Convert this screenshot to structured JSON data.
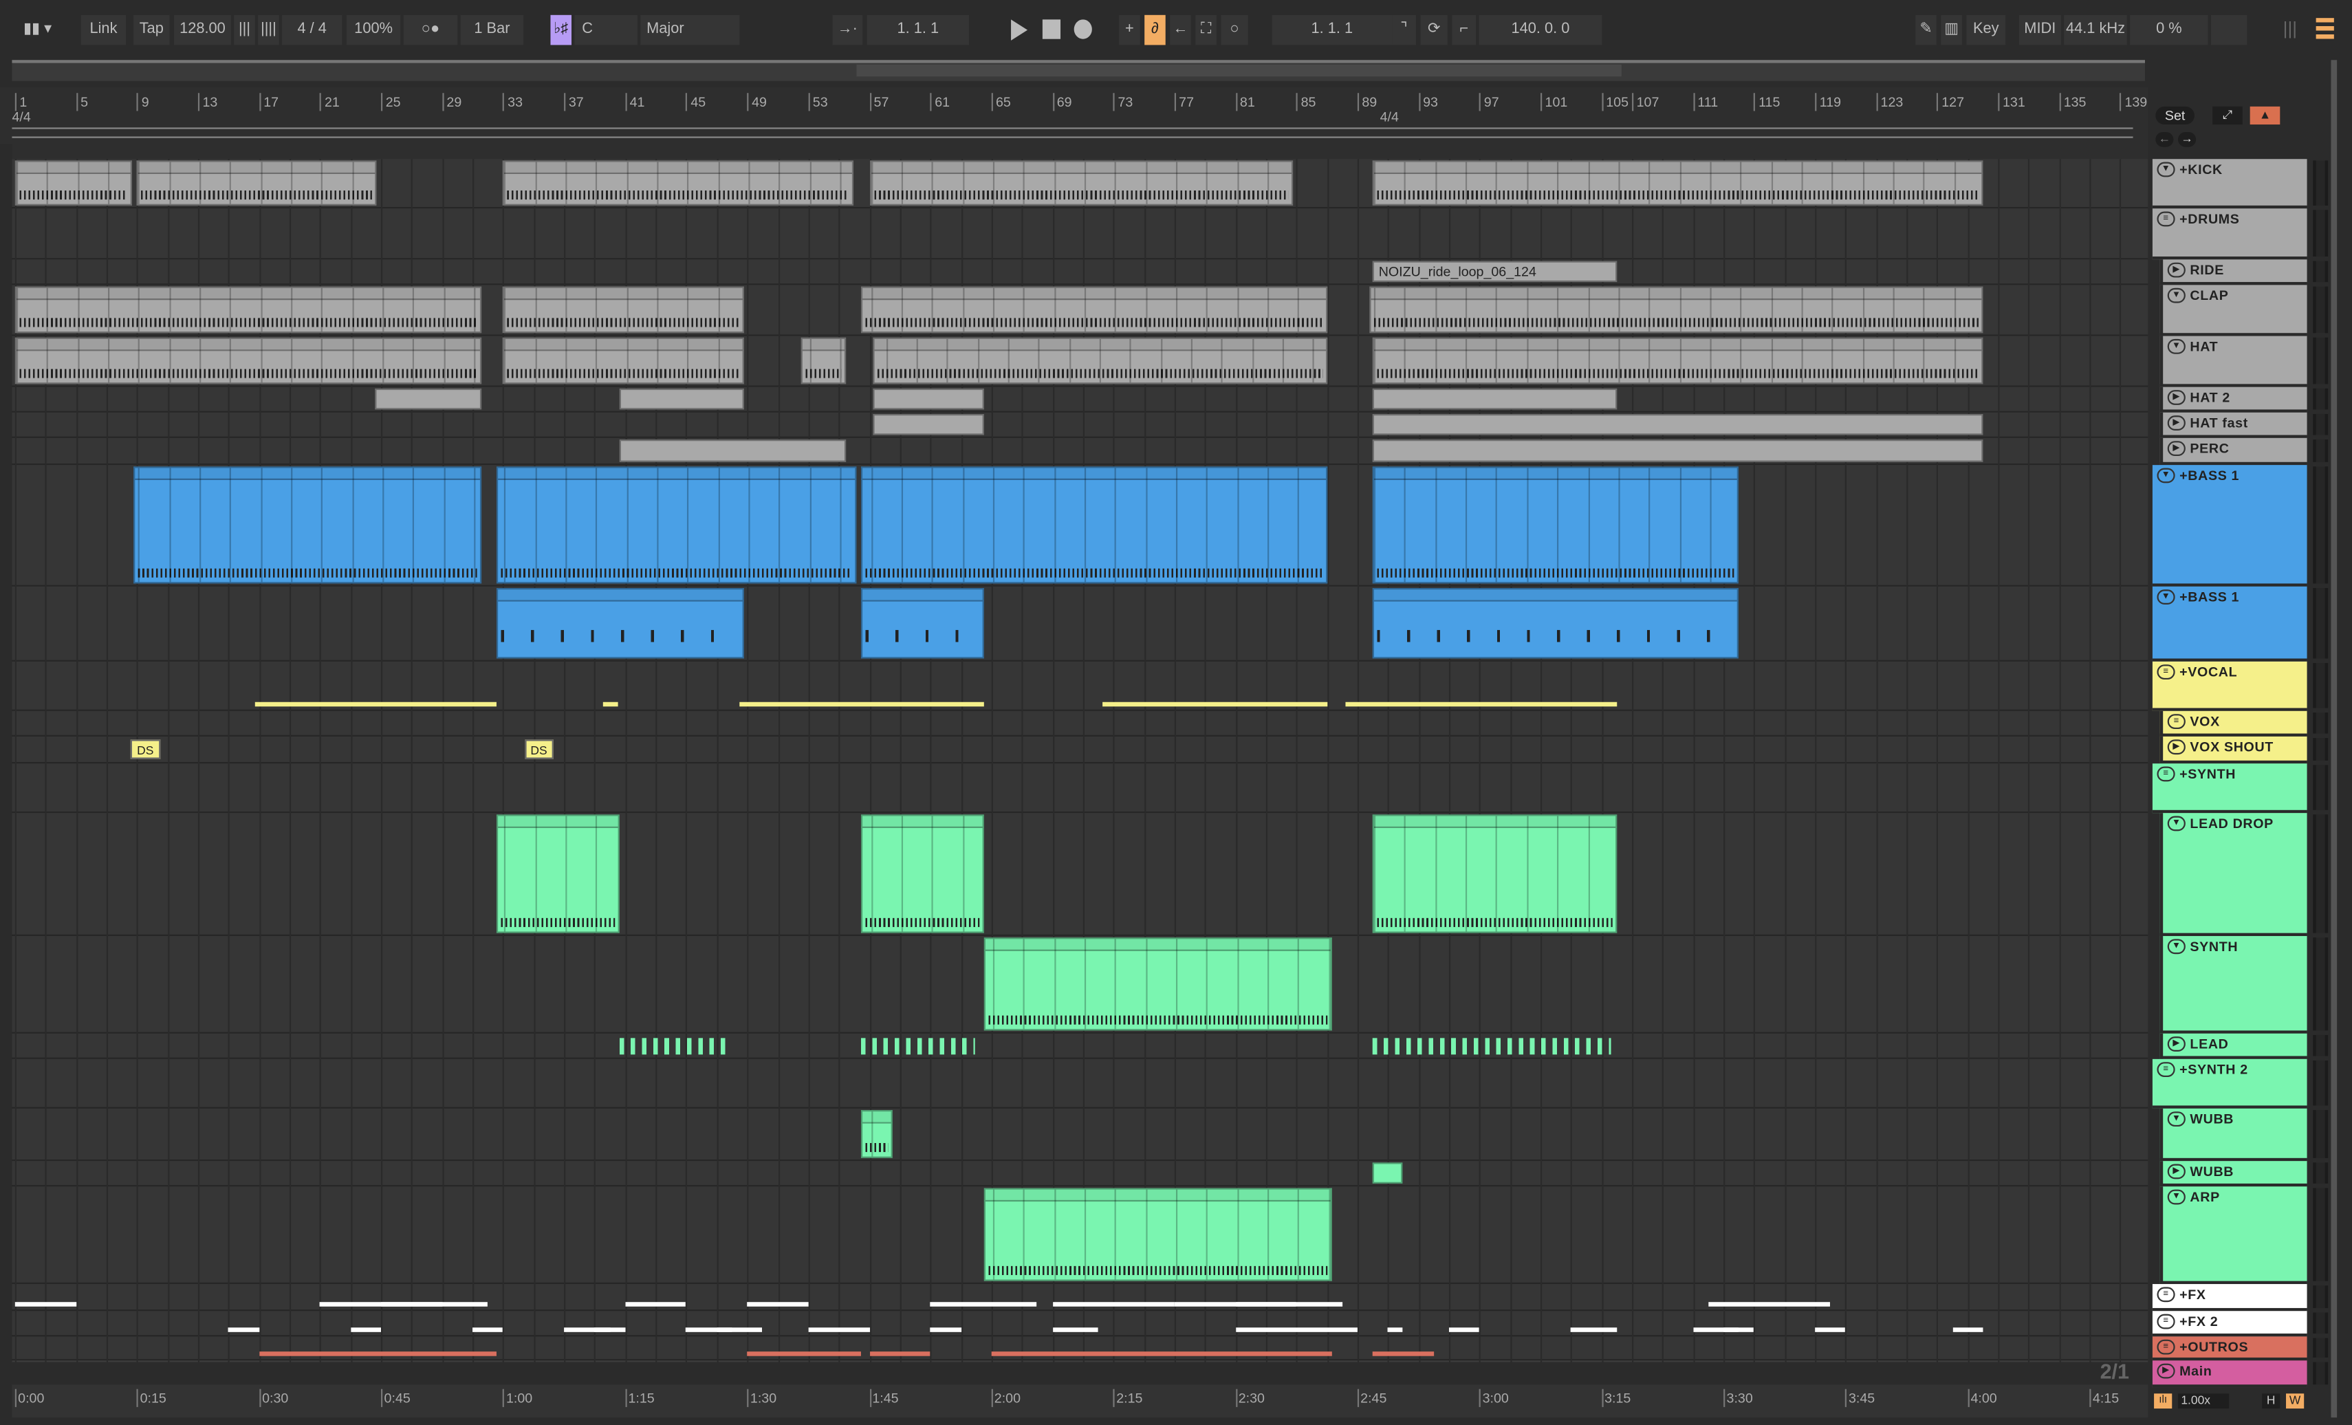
{
  "toolbar": {
    "link": "Link",
    "tap": "Tap",
    "tempo": "128.00",
    "signature": "4 / 4",
    "zoom": "100%",
    "follow": "○●",
    "quantize": "1 Bar",
    "scale_icon": "♭♯",
    "key": "C",
    "scale": "Major",
    "position": "1.  1.  1",
    "loop_start": "1.  1.  1",
    "loop_length": "140.  0.  0",
    "key_map": "Key",
    "midi_map": "MIDI",
    "sample_rate": "44.1 kHz",
    "cpu": "0 %",
    "accent": "#f3ad63",
    "scale_accent": "#b79cf5"
  },
  "ruler": {
    "bars": [
      1,
      5,
      9,
      13,
      17,
      21,
      25,
      29,
      33,
      37,
      41,
      45,
      49,
      53,
      57,
      61,
      65,
      69,
      73,
      77,
      81,
      85,
      89,
      93,
      97,
      101,
      105,
      107,
      111,
      115,
      119,
      123,
      127,
      131,
      135,
      139
    ],
    "signature": "4/4",
    "signature2": "4/4"
  },
  "set_button": "Set",
  "tracks": [
    {
      "name": "+KICK",
      "color": "#a9a9a9",
      "icon": "fold",
      "group": true,
      "clips": [
        [
          1,
          8.7
        ],
        [
          9,
          24.7
        ],
        [
          33,
          56
        ],
        [
          57,
          84.8
        ],
        [
          90,
          130
        ]
      ],
      "kind": "midi"
    },
    {
      "name": "+DRUMS",
      "color": "#a9a9a9",
      "icon": "group",
      "group": true,
      "clips": [],
      "kind": "midi"
    },
    {
      "name": "RIDE",
      "color": "#a9a9a9",
      "icon": "play",
      "group": false,
      "clips": [
        [
          90,
          106
        ]
      ],
      "clip_label": "NOIZU_ride_loop_06_124",
      "kind": "audio"
    },
    {
      "name": "CLAP",
      "color": "#a9a9a9",
      "icon": "fold",
      "group": false,
      "clips": [
        [
          1,
          31.6
        ],
        [
          33,
          48.8
        ],
        [
          56.5,
          87
        ],
        [
          89.8,
          130
        ]
      ],
      "kind": "midi"
    },
    {
      "name": "HAT",
      "color": "#a9a9a9",
      "icon": "fold",
      "group": false,
      "clips": [
        [
          1,
          31.6
        ],
        [
          33,
          48.8
        ],
        [
          52.5,
          55.5
        ],
        [
          57.2,
          87
        ],
        [
          90,
          130
        ]
      ],
      "kind": "midi"
    },
    {
      "name": "HAT 2",
      "color": "#a9a9a9",
      "icon": "play",
      "group": false,
      "clips": [
        [
          24.6,
          31.6
        ],
        [
          40.6,
          48.8
        ],
        [
          57.2,
          64.5
        ],
        [
          90,
          106
        ]
      ],
      "kind": "flat"
    },
    {
      "name": "HAT  fast",
      "color": "#a9a9a9",
      "icon": "play",
      "group": false,
      "clips": [
        [
          57.2,
          64.5
        ],
        [
          90,
          130
        ]
      ],
      "kind": "flat"
    },
    {
      "name": "PERC",
      "color": "#a9a9a9",
      "icon": "play",
      "group": false,
      "clips": [
        [
          40.6,
          55.5
        ],
        [
          90,
          130
        ]
      ],
      "kind": "flat"
    },
    {
      "name": "+BASS 1",
      "color": "#4aa0e6",
      "icon": "fold",
      "group": true,
      "clips": [
        [
          8.8,
          31.6
        ],
        [
          32.6,
          56.2
        ],
        [
          56.5,
          87
        ],
        [
          90,
          114
        ]
      ],
      "kind": "midi"
    },
    {
      "name": "+BASS 1",
      "color": "#4aa0e6",
      "icon": "fold",
      "group": true,
      "clips": [
        [
          32.6,
          48.8
        ],
        [
          56.5,
          64.5
        ],
        [
          90,
          114
        ]
      ],
      "kind": "sparse"
    },
    {
      "name": "+VOCAL",
      "color": "#f5f08a",
      "icon": "group",
      "group": true,
      "clips": [
        [
          16.7,
          32.6
        ],
        [
          39.5,
          40.5
        ],
        [
          48.5,
          64.5
        ],
        [
          72.3,
          87
        ],
        [
          88.2,
          106
        ]
      ],
      "kind": "thin"
    },
    {
      "name": "VOX",
      "color": "#f5f08a",
      "icon": "group",
      "group": false,
      "clips": [],
      "kind": "flat"
    },
    {
      "name": "VOX SHOUT",
      "color": "#f5f08a",
      "icon": "play",
      "group": false,
      "clips": [
        [
          8.6,
          10.5
        ],
        [
          34.4,
          36.3
        ]
      ],
      "clip_label": "DS",
      "kind": "label"
    },
    {
      "name": "+SYNTH",
      "color": "#7af5b0",
      "icon": "group",
      "group": true,
      "clips": [],
      "kind": "flat"
    },
    {
      "name": "LEAD DROP",
      "color": "#7af5b0",
      "icon": "fold",
      "group": false,
      "clips": [
        [
          32.6,
          40.6
        ],
        [
          56.5,
          64.5
        ],
        [
          90,
          106
        ]
      ],
      "kind": "midi"
    },
    {
      "name": "SYNTH",
      "color": "#7af5b0",
      "icon": "fold",
      "group": false,
      "clips": [
        [
          64.5,
          87.3
        ]
      ],
      "kind": "midi"
    },
    {
      "name": "LEAD",
      "color": "#7af5b0",
      "icon": "play",
      "group": false,
      "clips": [
        [
          40.6,
          48
        ],
        [
          56.5,
          63.9
        ],
        [
          90,
          105.6
        ]
      ],
      "kind": "pulse"
    },
    {
      "name": "+SYNTH 2",
      "color": "#7af5b0",
      "icon": "group",
      "group": true,
      "clips": [],
      "kind": "flat"
    },
    {
      "name": "WUBB",
      "color": "#7af5b0",
      "icon": "fold",
      "group": false,
      "clips": [
        [
          56.5,
          58.5
        ]
      ],
      "kind": "midi"
    },
    {
      "name": "WUBB",
      "color": "#7af5b0",
      "icon": "play",
      "group": false,
      "clips": [
        [
          90,
          92
        ]
      ],
      "kind": "flat"
    },
    {
      "name": "ARP",
      "color": "#7af5b0",
      "icon": "fold",
      "group": false,
      "clips": [
        [
          64.5,
          87.3
        ]
      ],
      "kind": "midi"
    },
    {
      "name": "+FX",
      "color": "#ffffff",
      "icon": "group",
      "group": true,
      "clips": [
        [
          1,
          5
        ],
        [
          21,
          29
        ],
        [
          25,
          32
        ],
        [
          41,
          45
        ],
        [
          49,
          53
        ],
        [
          61,
          68
        ],
        [
          69,
          77
        ],
        [
          77,
          85
        ],
        [
          81,
          88
        ],
        [
          112,
          120
        ]
      ],
      "kind": "thin"
    },
    {
      "name": "+FX 2",
      "color": "#ffffff",
      "icon": "group",
      "group": true,
      "clips": [
        [
          15,
          17
        ],
        [
          23,
          25
        ],
        [
          31,
          33
        ],
        [
          37,
          40
        ],
        [
          39,
          41
        ],
        [
          45,
          48
        ],
        [
          47,
          50
        ],
        [
          53,
          57
        ],
        [
          61,
          63
        ],
        [
          69,
          72
        ],
        [
          81,
          89
        ],
        [
          91,
          92
        ],
        [
          95,
          97
        ],
        [
          103,
          106
        ],
        [
          111,
          114
        ],
        [
          113,
          115
        ],
        [
          119,
          121
        ],
        [
          128,
          130
        ]
      ],
      "kind": "thin"
    },
    {
      "name": "+OUTROS",
      "color": "#d9705f",
      "icon": "group",
      "group": true,
      "clips": [
        [
          17,
          32.6
        ],
        [
          49,
          56.5
        ],
        [
          57,
          61
        ],
        [
          65,
          87.3
        ],
        [
          90,
          94
        ]
      ],
      "kind": "thin"
    },
    {
      "name": "Main",
      "color": "#d45ea0",
      "icon": "play",
      "group": true,
      "clips": [],
      "kind": "flat"
    }
  ],
  "main_meter_label": "2/1",
  "time_ruler": [
    "0:00",
    "0:15",
    "0:30",
    "0:45",
    "1:00",
    "1:15",
    "1:30",
    "1:45",
    "2:00",
    "2:15",
    "2:30",
    "2:45",
    "3:00",
    "3:15",
    "3:30",
    "3:45",
    "4:00",
    "4:15"
  ],
  "footer": {
    "zoom_value": "1.00x",
    "h_label": "H",
    "w_label": "W"
  }
}
